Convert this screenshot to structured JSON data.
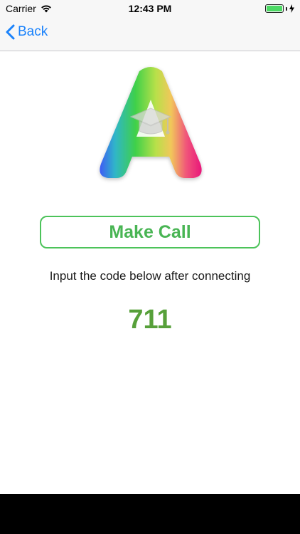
{
  "status_bar": {
    "carrier": "Carrier",
    "time": "12:43 PM",
    "battery_color": "#4cd964"
  },
  "nav": {
    "back_label": "Back",
    "accent_color": "#1a82fb"
  },
  "logo": {
    "icon": "graduation-cap-icon"
  },
  "main": {
    "make_call_label": "Make Call",
    "instruction": "Input the code below after connecting",
    "code": "711",
    "button_color": "#4cc35a",
    "code_color": "#57a03a"
  }
}
